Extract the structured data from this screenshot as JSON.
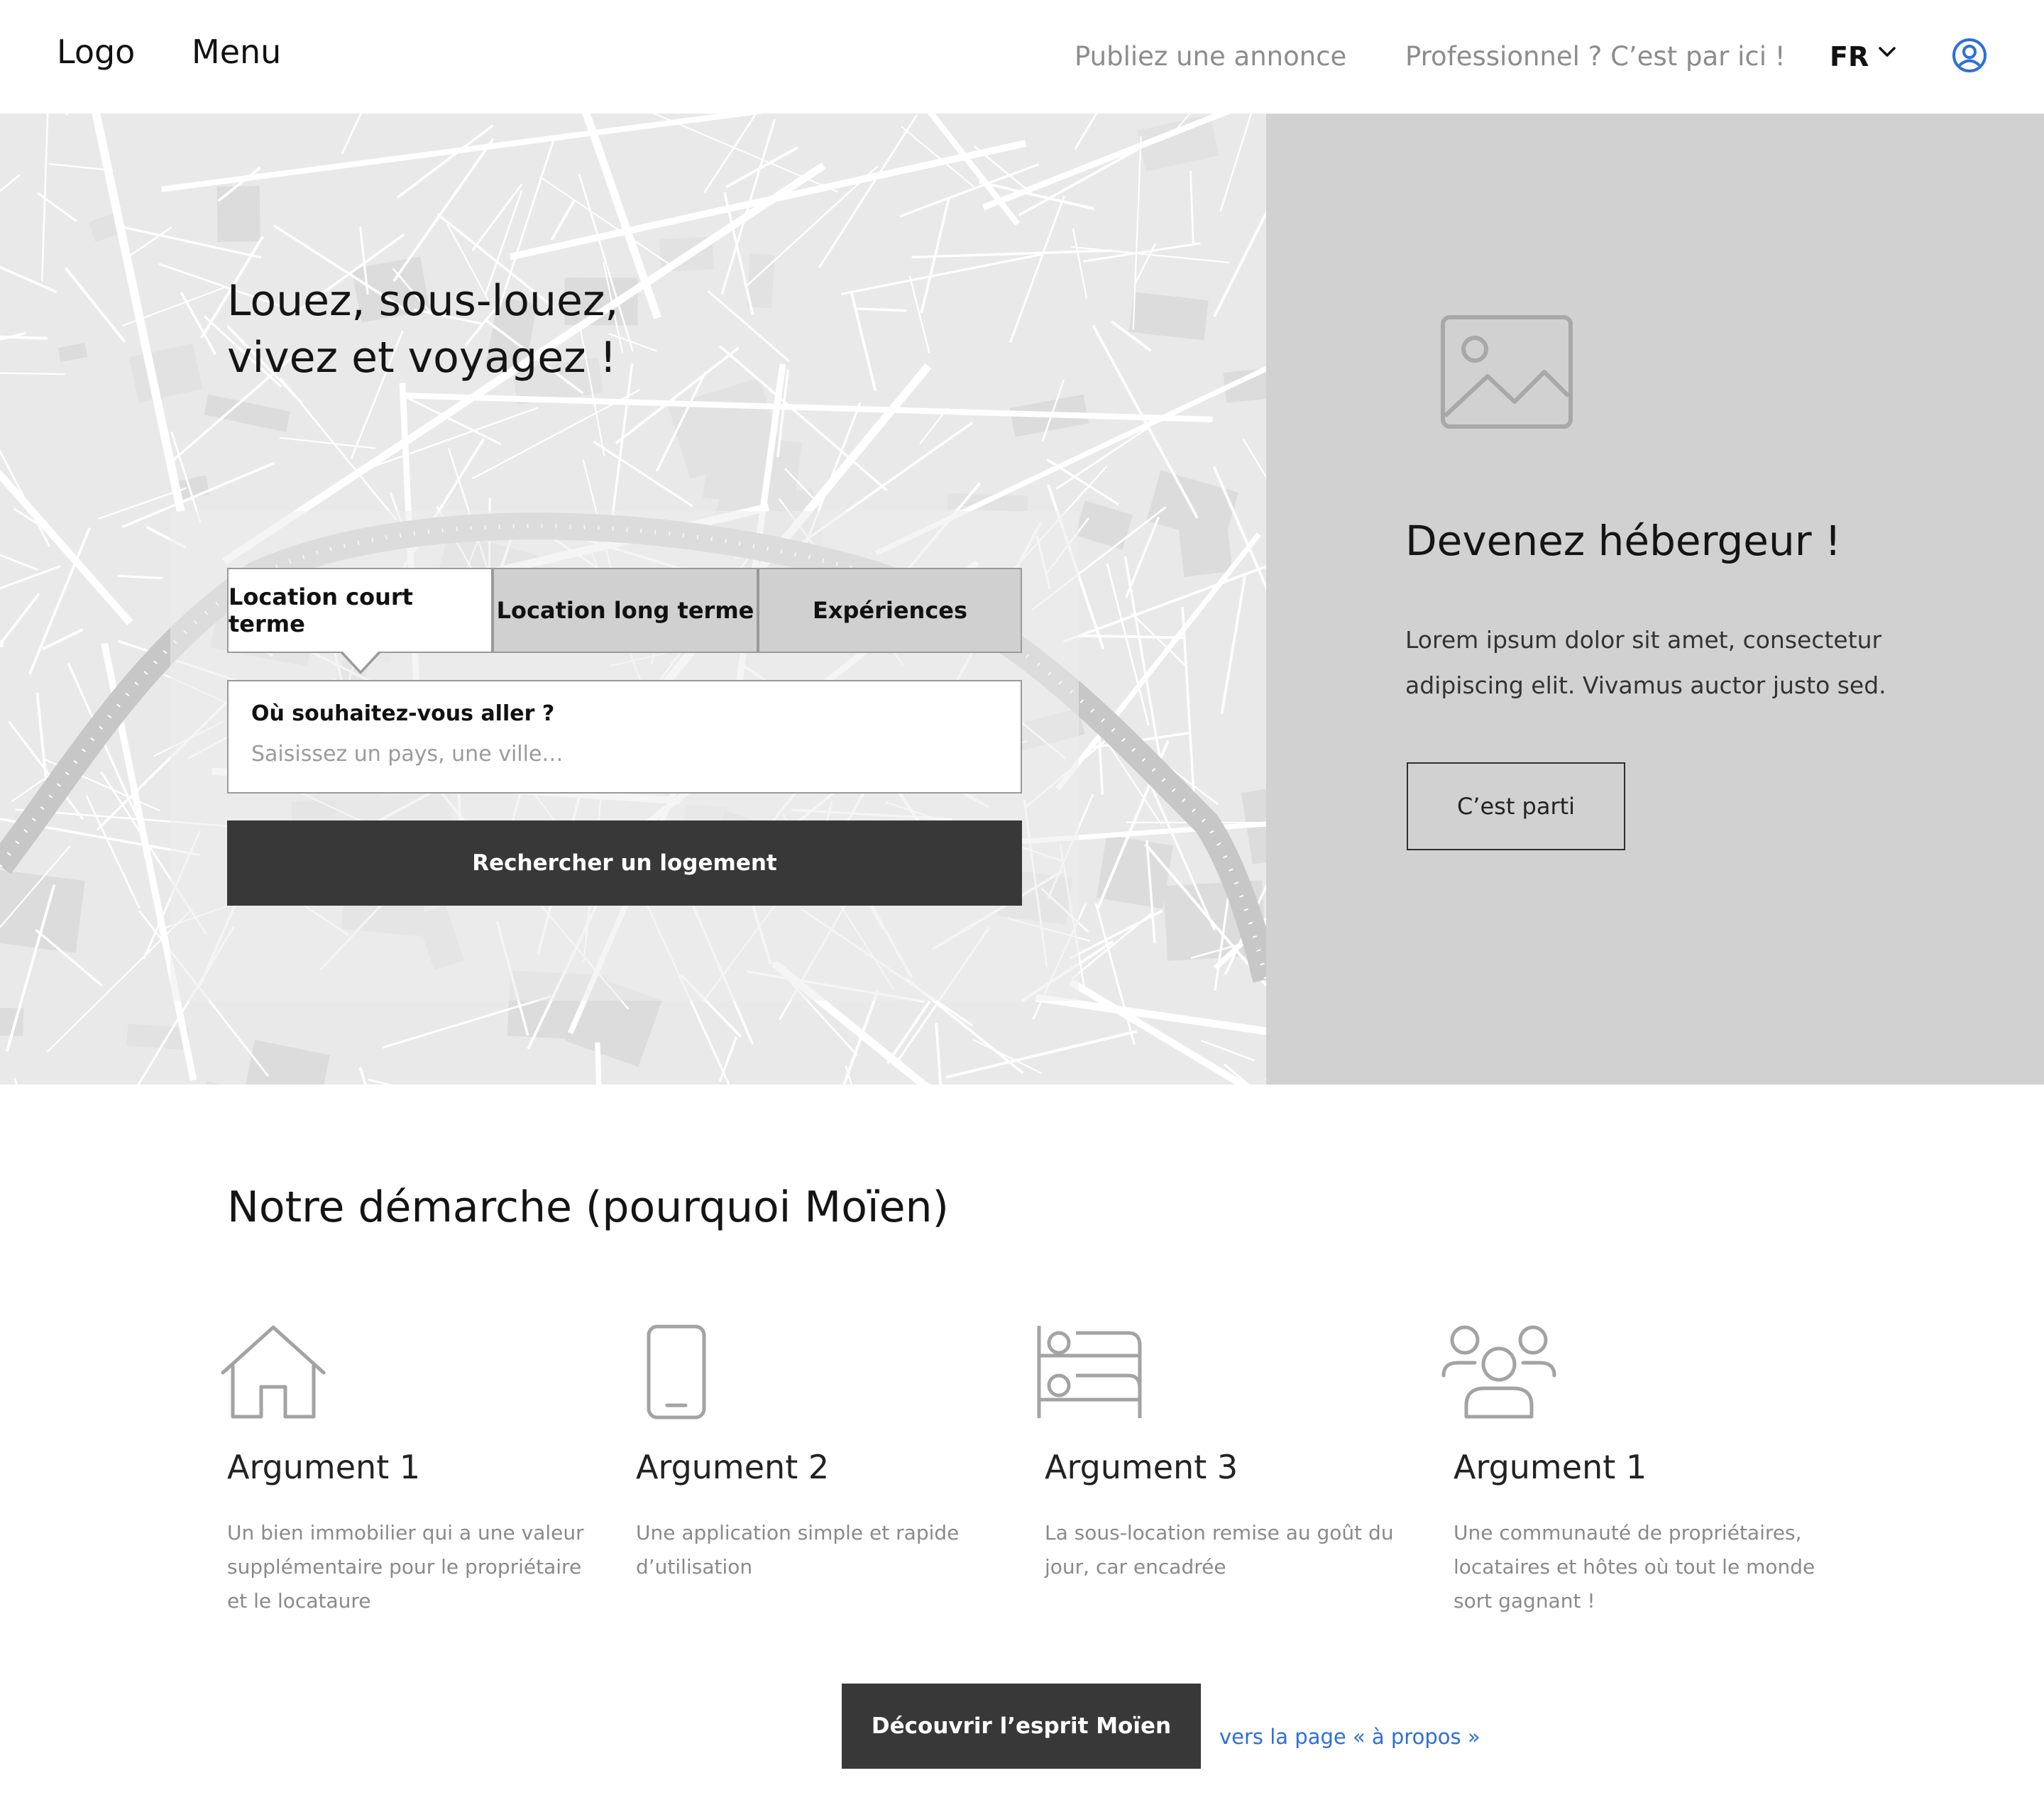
{
  "header": {
    "logo": "Logo",
    "menu_label": "Menu",
    "publish_link": "Publiez une annonce",
    "pro_link": "Professionnel ? C’est par ici !",
    "language": "FR",
    "user_icon": "user-circle-icon",
    "accent_color": "#2d6fd8"
  },
  "hero": {
    "title_line1": "Louez, sous-louez,",
    "title_line2": "vivez et voyagez !",
    "background": "city-map",
    "tabs": [
      {
        "label": "Location court terme",
        "active": true
      },
      {
        "label": "Location long terme",
        "active": false
      },
      {
        "label": "Expériences",
        "active": false
      }
    ],
    "search": {
      "label": "Où souhaitez-vous aller ?",
      "placeholder": "Saisissez un pays, une ville…",
      "value": ""
    },
    "search_button": "Rechercher un logement"
  },
  "host": {
    "image_icon": "image-placeholder-icon",
    "title": "Devenez hébergeur !",
    "text": "Lorem ipsum dolor sit amet, consectetur adipiscing elit. Vivamus auctor justo sed.",
    "button": "C’est parti"
  },
  "approach": {
    "title": "Notre démarche (pourquoi Moïen)",
    "arguments": [
      {
        "icon": "house-icon",
        "title": "Argument 1",
        "text": "Un bien immobilier qui a une valeur supplémentaire pour le propriétaire et le locataure"
      },
      {
        "icon": "phone-icon",
        "title": "Argument 2",
        "text": "Une application simple et rapide d’utilisation"
      },
      {
        "icon": "bunk-bed-icon",
        "title": "Argument 3",
        "text": "La sous-location remise au goût du jour, car encadrée"
      },
      {
        "icon": "community-icon",
        "title": "Argument 1",
        "text": "Une communauté de propriétaires, locataires et hôtes où tout le monde sort gagnant !"
      }
    ],
    "discover_button": "Découvrir l’esprit Moïen",
    "about_link": "vers la page « à propos »"
  }
}
